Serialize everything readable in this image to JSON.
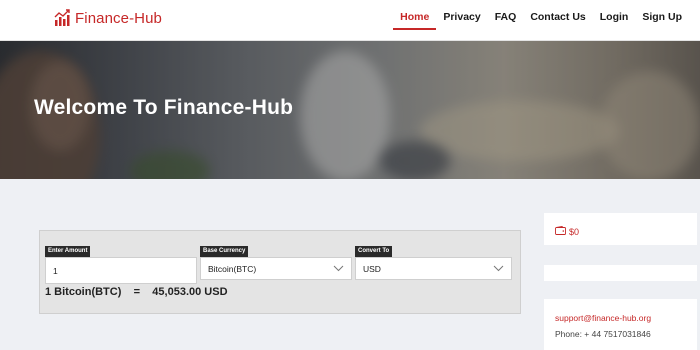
{
  "header": {
    "logo_text": "Finance-Hub",
    "nav": [
      "Home",
      "Privacy",
      "FAQ",
      "Contact Us",
      "Login",
      "Sign Up"
    ],
    "active_nav": "Home"
  },
  "hero": {
    "title": "Welcome To Finance-Hub"
  },
  "converter": {
    "amount_label": "Enter Amount",
    "amount_value": "1",
    "base_label": "Base Currency",
    "base_value": "Bitcoin(BTC)",
    "convert_label": "Convert To",
    "convert_value": "USD",
    "result_from": "1 Bitcoin(BTC)",
    "result_eq": "=",
    "result_to": "45,053.00 USD"
  },
  "sidebar": {
    "balance": "$0",
    "email": "support@finance-hub.org",
    "phone": "Phone: + 44 7517031846"
  },
  "colors": {
    "accent": "#c62828",
    "page_bg": "#eef0f4",
    "label_bg": "#2a2a2a"
  },
  "icons": {
    "logo": "bar-chart-trend-icon",
    "balance": "wallet-icon",
    "dropdown": "chevron-down-icon"
  }
}
